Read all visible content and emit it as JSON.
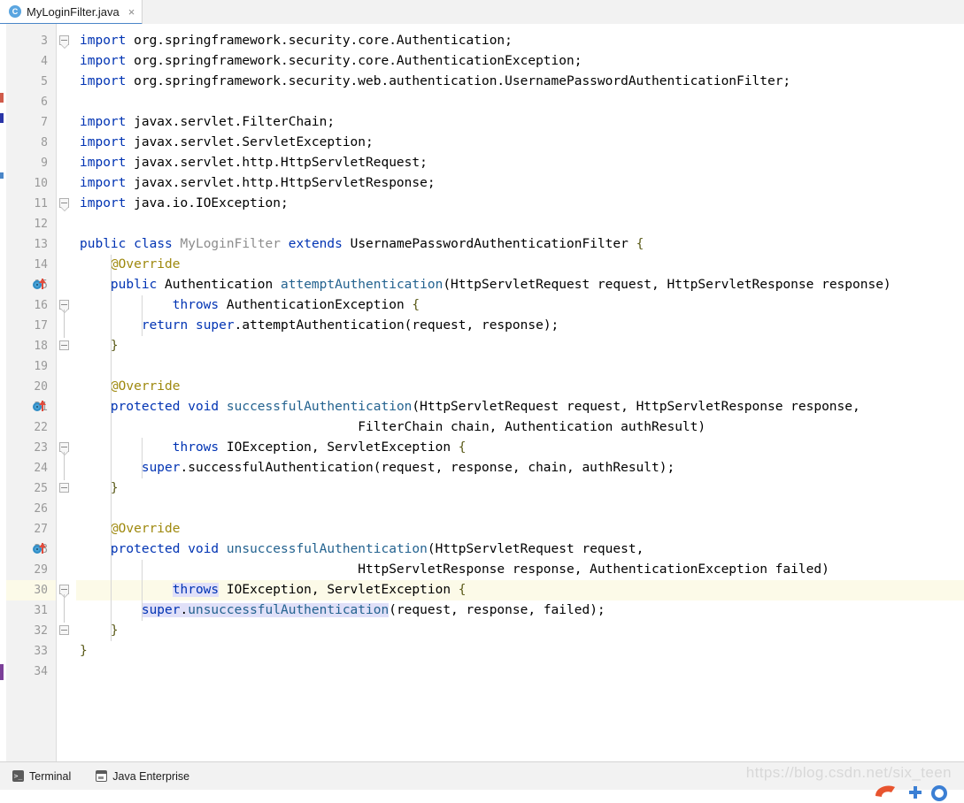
{
  "tab": {
    "label": "MyLoginFilter.java",
    "icon": "class-icon",
    "icon_letter": "C",
    "close_icon": "close-icon",
    "close_glyph": "×"
  },
  "editor": {
    "first_line": 3,
    "current_line": 30,
    "lines": [
      {
        "n": 3,
        "indent": 0,
        "fold": "start",
        "tokens": [
          {
            "t": "import",
            "c": "kw"
          },
          {
            "t": " org.springframework.security.core.Authentication;",
            "c": ""
          }
        ]
      },
      {
        "n": 4,
        "indent": 0,
        "tokens": [
          {
            "t": "import",
            "c": "kw"
          },
          {
            "t": " org.springframework.security.core.AuthenticationException;",
            "c": ""
          }
        ]
      },
      {
        "n": 5,
        "indent": 0,
        "tokens": [
          {
            "t": "import",
            "c": "kw"
          },
          {
            "t": " org.springframework.security.web.authentication.UsernamePasswordAuthenticationFilter;",
            "c": ""
          }
        ]
      },
      {
        "n": 6,
        "indent": 0,
        "tokens": []
      },
      {
        "n": 7,
        "indent": 0,
        "tokens": [
          {
            "t": "import",
            "c": "kw"
          },
          {
            "t": " javax.servlet.FilterChain;",
            "c": ""
          }
        ]
      },
      {
        "n": 8,
        "indent": 0,
        "tokens": [
          {
            "t": "import",
            "c": "kw"
          },
          {
            "t": " javax.servlet.ServletException;",
            "c": ""
          }
        ]
      },
      {
        "n": 9,
        "indent": 0,
        "tokens": [
          {
            "t": "import",
            "c": "kw"
          },
          {
            "t": " javax.servlet.http.HttpServletRequest;",
            "c": ""
          }
        ]
      },
      {
        "n": 10,
        "indent": 0,
        "tokens": [
          {
            "t": "import",
            "c": "kw"
          },
          {
            "t": " javax.servlet.http.HttpServletResponse;",
            "c": ""
          }
        ]
      },
      {
        "n": 11,
        "indent": 0,
        "fold": "start",
        "tokens": [
          {
            "t": "import",
            "c": "kw"
          },
          {
            "t": " java.io.IOException;",
            "c": ""
          }
        ]
      },
      {
        "n": 12,
        "indent": 0,
        "tokens": []
      },
      {
        "n": 13,
        "indent": 0,
        "tokens": [
          {
            "t": "public",
            "c": "kw"
          },
          {
            "t": " ",
            "c": ""
          },
          {
            "t": "class",
            "c": "kw"
          },
          {
            "t": " ",
            "c": ""
          },
          {
            "t": "MyLoginFilter",
            "c": "cls"
          },
          {
            "t": " ",
            "c": ""
          },
          {
            "t": "extends",
            "c": "kw"
          },
          {
            "t": " UsernamePasswordAuthenticationFilter ",
            "c": ""
          },
          {
            "t": "{",
            "c": "brc"
          }
        ]
      },
      {
        "n": 14,
        "indent": 1,
        "tokens": [
          {
            "t": "@Override",
            "c": "ann"
          }
        ]
      },
      {
        "n": 15,
        "indent": 1,
        "marker": "override",
        "tokens": [
          {
            "t": "public",
            "c": "kw"
          },
          {
            "t": " Authentication ",
            "c": ""
          },
          {
            "t": "attemptAuthentication",
            "c": "mth"
          },
          {
            "t": "(HttpServletRequest request, HttpServletResponse response)",
            "c": ""
          }
        ]
      },
      {
        "n": 16,
        "indent": 3,
        "fold": "start",
        "tokens": [
          {
            "t": "throws",
            "c": "kw"
          },
          {
            "t": " AuthenticationException ",
            "c": ""
          },
          {
            "t": "{",
            "c": "brc"
          }
        ]
      },
      {
        "n": 17,
        "indent": 2,
        "tokens": [
          {
            "t": "return",
            "c": "kw"
          },
          {
            "t": " ",
            "c": ""
          },
          {
            "t": "super",
            "c": "kw"
          },
          {
            "t": ".attemptAuthentication(request, response);",
            "c": ""
          }
        ]
      },
      {
        "n": 18,
        "indent": 1,
        "fold": "end",
        "tokens": [
          {
            "t": "}",
            "c": "brc"
          }
        ]
      },
      {
        "n": 19,
        "indent": 0,
        "tokens": []
      },
      {
        "n": 20,
        "indent": 1,
        "tokens": [
          {
            "t": "@Override",
            "c": "ann"
          }
        ]
      },
      {
        "n": 21,
        "indent": 1,
        "marker": "override",
        "tokens": [
          {
            "t": "protected",
            "c": "kw"
          },
          {
            "t": " ",
            "c": ""
          },
          {
            "t": "void",
            "c": "kw"
          },
          {
            "t": " ",
            "c": ""
          },
          {
            "t": "successfulAuthentication",
            "c": "mth"
          },
          {
            "t": "(HttpServletRequest request, HttpServletResponse response,",
            "c": ""
          }
        ]
      },
      {
        "n": 22,
        "indent": 9,
        "tokens": [
          {
            "t": "FilterChain chain, Authentication authResult)",
            "c": ""
          }
        ]
      },
      {
        "n": 23,
        "indent": 3,
        "fold": "start",
        "tokens": [
          {
            "t": "throws",
            "c": "kw"
          },
          {
            "t": " IOException, ServletException ",
            "c": ""
          },
          {
            "t": "{",
            "c": "brc"
          }
        ]
      },
      {
        "n": 24,
        "indent": 2,
        "tokens": [
          {
            "t": "super",
            "c": "kw"
          },
          {
            "t": ".successfulAuthentication(request, response, chain, authResult);",
            "c": ""
          }
        ]
      },
      {
        "n": 25,
        "indent": 1,
        "fold": "end",
        "tokens": [
          {
            "t": "}",
            "c": "brc"
          }
        ]
      },
      {
        "n": 26,
        "indent": 0,
        "tokens": []
      },
      {
        "n": 27,
        "indent": 1,
        "tokens": [
          {
            "t": "@Override",
            "c": "ann"
          }
        ]
      },
      {
        "n": 28,
        "indent": 1,
        "marker": "override",
        "tokens": [
          {
            "t": "protected",
            "c": "kw"
          },
          {
            "t": " ",
            "c": ""
          },
          {
            "t": "void",
            "c": "kw"
          },
          {
            "t": " ",
            "c": ""
          },
          {
            "t": "unsuccessfulAuthentication",
            "c": "mth"
          },
          {
            "t": "(HttpServletRequest request,",
            "c": ""
          }
        ]
      },
      {
        "n": 29,
        "indent": 9,
        "tokens": [
          {
            "t": "HttpServletResponse response, AuthenticationException failed)",
            "c": ""
          }
        ]
      },
      {
        "n": 30,
        "indent": 3,
        "fold": "start",
        "current": true,
        "tokens": [
          {
            "t": "throws",
            "c": "kw sel"
          },
          {
            "t": " IOException, ServletException ",
            "c": ""
          },
          {
            "t": "{",
            "c": "brc"
          }
        ]
      },
      {
        "n": 31,
        "indent": 2,
        "tokens": [
          {
            "t": "super",
            "c": "kw sel"
          },
          {
            "t": ".",
            "c": "sel"
          },
          {
            "t": "unsuccessfulAuthentication",
            "c": "mth sel"
          },
          {
            "t": "(request, response, failed);",
            "c": ""
          }
        ]
      },
      {
        "n": 32,
        "indent": 1,
        "fold": "end",
        "tokens": [
          {
            "t": "}",
            "c": "brc"
          }
        ]
      },
      {
        "n": 33,
        "indent": 0,
        "tokens": [
          {
            "t": "}",
            "c": "brc"
          }
        ]
      },
      {
        "n": 34,
        "indent": 0,
        "tokens": []
      }
    ]
  },
  "statusbar": {
    "items": [
      {
        "label": "Terminal",
        "icon": "terminal-icon"
      },
      {
        "label": "Java Enterprise",
        "icon": "java-enterprise-icon"
      }
    ]
  },
  "watermark": {
    "text": "https://blog.csdn.net/six_teen"
  },
  "colors": {
    "keyword": "#0033b3",
    "class_name": "#8c8c8c",
    "annotation": "#9e880d",
    "method": "#23628f",
    "brace": "#5a5a18",
    "selection": "#e0e0f8",
    "current_line": "#fcfae8",
    "gutter_bg": "#f2f2f2",
    "tab_underline": "#4a86c8"
  }
}
